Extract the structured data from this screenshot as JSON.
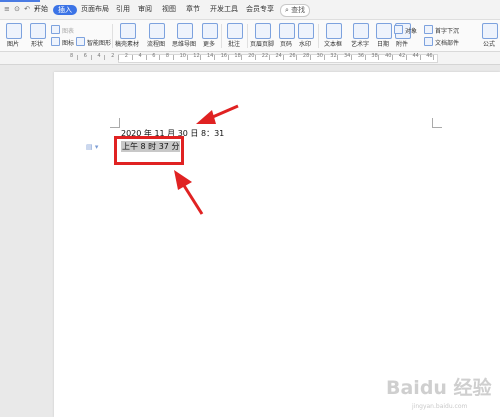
{
  "menubar": {
    "tabs": [
      {
        "id": "start",
        "label": "开始"
      },
      {
        "id": "insert",
        "label": "插入"
      },
      {
        "id": "layout",
        "label": "页面布局"
      },
      {
        "id": "references",
        "label": "引用"
      },
      {
        "id": "review",
        "label": "审阅"
      },
      {
        "id": "view",
        "label": "视图"
      },
      {
        "id": "chapter",
        "label": "章节"
      },
      {
        "id": "devtools",
        "label": "开发工具"
      },
      {
        "id": "member",
        "label": "会员专享"
      }
    ],
    "search_label": "查找",
    "sys_icons": "≡ ⊙ ↶ ▾"
  },
  "ribbon": {
    "picture": "图片",
    "shape": "形状",
    "icon": "图标",
    "chart": "图表",
    "smartart": "智能图形",
    "material": "稿壳素材",
    "flowchart": "流程图",
    "mindmap": "思维导图",
    "more": "更多",
    "comment": "批注",
    "header_footer": "页眉页脚",
    "page_number": "页码",
    "watermark": "水印",
    "textbox": "文本框",
    "wordart": "艺术字",
    "date": "日期",
    "attachment": "附件",
    "object": "对象",
    "dropcap": "首字下沉",
    "docparts": "文档部件",
    "formula": "公式"
  },
  "ruler": {
    "numbers": [
      "8",
      "6",
      "4",
      "2",
      "2",
      "4",
      "6",
      "8",
      "10",
      "12",
      "14",
      "16",
      "18",
      "20",
      "22",
      "24",
      "26",
      "28",
      "30",
      "32",
      "34",
      "36",
      "38",
      "40",
      "42",
      "44",
      "46"
    ]
  },
  "document": {
    "line1": "2020 年 11 月 30 日 8：31",
    "line2": "上午 8 时 37 分"
  },
  "watermark": {
    "brand": "Baidu 经验",
    "url": "jingyan.baidu.com"
  },
  "colors": {
    "accent": "#3b73e6",
    "annotation_red": "#e02222"
  }
}
